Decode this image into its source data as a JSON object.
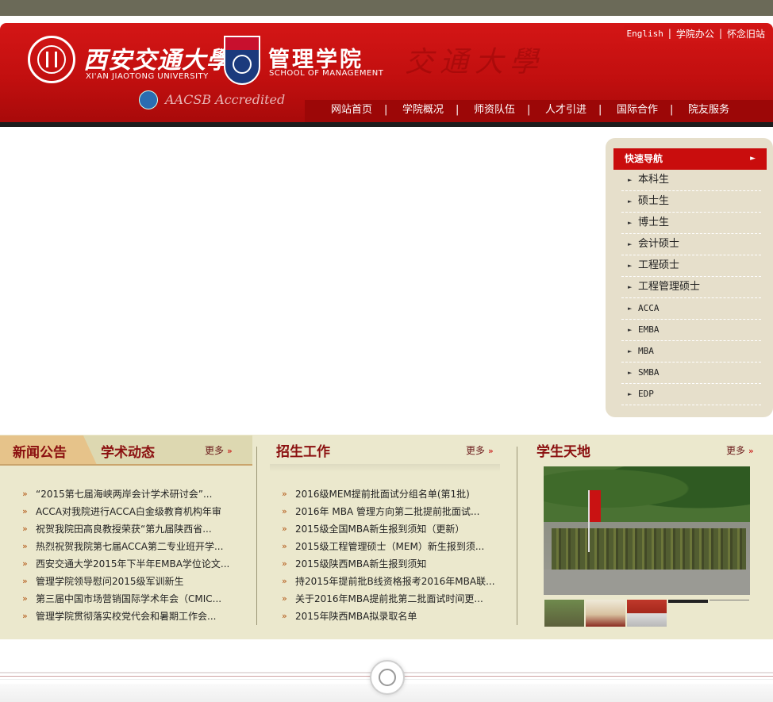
{
  "header": {
    "xjtu_name_cn": "西安交通大學",
    "xjtu_name_en": "XI'AN JIAOTONG UNIVERSITY",
    "school_name_cn": "管理学院",
    "school_name_en": "SCHOOL OF MANAGEMENT",
    "aacsb": "AACSB Accredited",
    "calligraphy": "交通大學",
    "top_links": [
      "English",
      "学院办公",
      "怀念旧站"
    ],
    "nav": [
      "网站首页",
      "学院概况",
      "师资队伍",
      "人才引进",
      "国际合作",
      "院友服务"
    ]
  },
  "sidebar": {
    "title": "快速导航",
    "arrow": "►",
    "items": [
      "本科生",
      "硕士生",
      "博士生",
      "会计硕士",
      "工程硕士",
      "工程管理硕士",
      "ACCA",
      "EMBA",
      "MBA",
      "SMBA",
      "EDP"
    ]
  },
  "news": {
    "tab_active": "新闻公告",
    "tab_other": "学术动态",
    "more": "更多",
    "more_chev": "»",
    "bullet": "»",
    "items": [
      "“2015第七届海峡两岸会计学术研讨会”...",
      "ACCA对我院进行ACCA白金级教育机构年审",
      "祝贺我院田高良教授荣获“第九届陕西省...",
      "热烈祝贺我院第七届ACCA第二专业班开学...",
      "西安交通大学2015年下半年EMBA学位论文...",
      "管理学院领导慰问2015级军训新生",
      "第三届中国市场营销国际学术年会（CMIC...",
      "管理学院贯彻落实校党代会和暑期工作会..."
    ]
  },
  "admissions": {
    "title": "招生工作",
    "more": "更多",
    "items": [
      "2016级MEM提前批面试分组名单(第1批)",
      "2016年 MBA 管理方向第二批提前批面试...",
      "2015级全国MBA新生报到须知（更新）",
      "2015级工程管理硕士（MEM）新生报到须...",
      "2015级陕西MBA新生报到须知",
      "持2015年提前批B线资格报考2016年MBA联...",
      "关于2016年MBA提前批第二批面试时间更...",
      "2015年陕西MBA拟录取名单"
    ]
  },
  "students": {
    "title": "学生天地",
    "more": "更多"
  }
}
